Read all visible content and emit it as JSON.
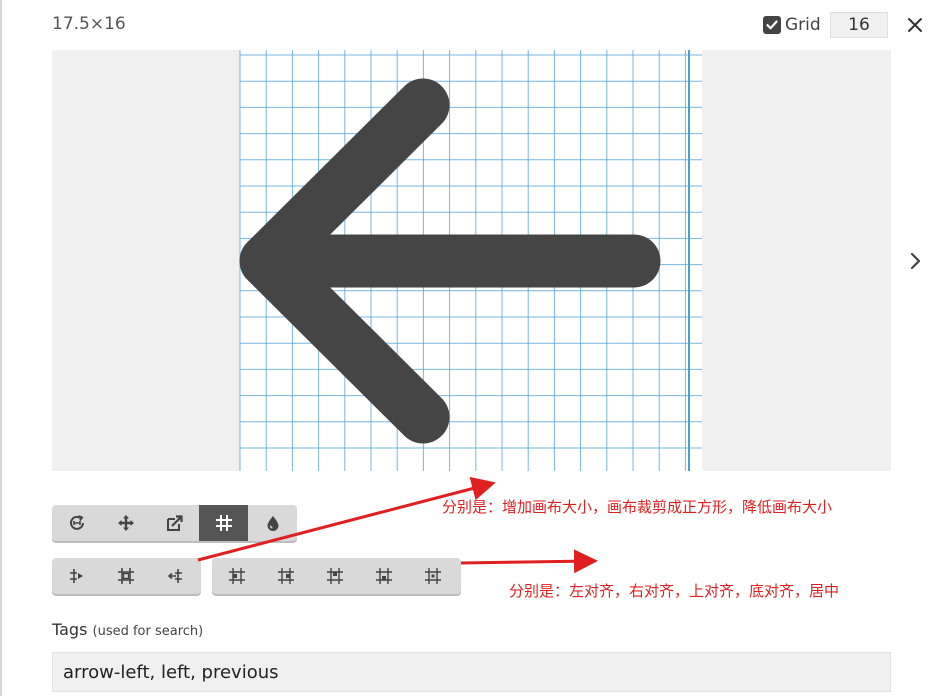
{
  "header": {
    "dimensions": "17.5×16",
    "grid_label": "Grid",
    "grid_checked": true,
    "grid_size": "16"
  },
  "icons": {
    "close": "close-icon",
    "next": "chevron-right-icon",
    "checkbox": "checkmark-icon"
  },
  "toolbar_top": [
    {
      "name": "tool-rotate",
      "icon": "rotate-icon"
    },
    {
      "name": "tool-move",
      "icon": "move-arrows-icon"
    },
    {
      "name": "tool-resize",
      "icon": "resize-icon"
    },
    {
      "name": "tool-grid",
      "icon": "grid-hash-icon",
      "active": true
    },
    {
      "name": "tool-color",
      "icon": "drop-icon"
    }
  ],
  "toolbar_bottom_a": [
    {
      "name": "tool-increase-canvas",
      "icon": "increase-canvas-icon"
    },
    {
      "name": "tool-crop-square",
      "icon": "crop-square-icon"
    },
    {
      "name": "tool-decrease-canvas",
      "icon": "decrease-canvas-icon"
    }
  ],
  "toolbar_bottom_b": [
    {
      "name": "tool-align-left",
      "icon": "align-left-icon"
    },
    {
      "name": "tool-align-right",
      "icon": "align-right-icon"
    },
    {
      "name": "tool-align-top",
      "icon": "align-top-icon"
    },
    {
      "name": "tool-align-bottom",
      "icon": "align-bottom-icon"
    },
    {
      "name": "tool-align-center",
      "icon": "align-center-icon"
    }
  ],
  "annotations": {
    "first": "分别是：增加画布大小，画布裁剪成正方形，降低画布大小",
    "second": "分别是：左对齐，右对齐，上对齐，底对齐，居中",
    "color": "#e02020"
  },
  "tags": {
    "label": "Tags",
    "hint": "(used for search)",
    "value": "arrow-left, left, previous"
  },
  "colors": {
    "grid_line": "#4a9fd8",
    "glyph": "#454545",
    "active_tool": "#555555"
  }
}
